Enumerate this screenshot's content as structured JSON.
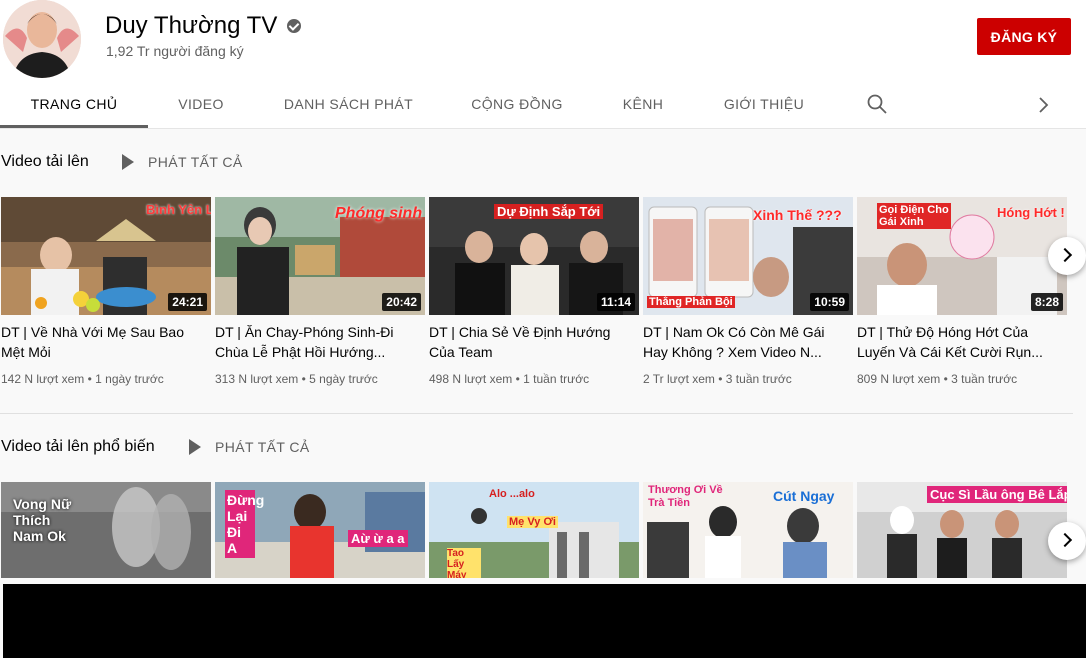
{
  "channel": {
    "name": "Duy Thường TV",
    "subscribers": "1,92 Tr người đăng ký",
    "subscribe_label": "ĐĂNG KÝ"
  },
  "tabs": [
    {
      "label": "TRANG CHỦ",
      "active": true
    },
    {
      "label": "VIDEO"
    },
    {
      "label": "DANH SÁCH PHÁT"
    },
    {
      "label": "CỘNG ĐỒNG"
    },
    {
      "label": "KÊNH"
    },
    {
      "label": "GIỚI THIỆU"
    }
  ],
  "icons": {
    "search": "search-icon",
    "chevron": "chevron-right-icon",
    "verified": "verified-icon",
    "play": "play-icon"
  },
  "colors": {
    "brand_red": "#cc0000",
    "secondary_text": "#606060",
    "background": "#f9f9f9"
  },
  "shelves": [
    {
      "title": "Video tải lên",
      "play_all": "PHÁT TẤT CẢ",
      "videos": [
        {
          "title": "DT | Về Nhà Với Mẹ Sau Bao Mệt Mỏi",
          "views": "142 N lượt xem",
          "age": "1 ngày trước",
          "duration": "24:21",
          "overlay": "Bình Yên Là Nhà"
        },
        {
          "title": "DT | Ăn Chay-Phóng Sinh-Đi Chùa Lễ Phật Hồi Hướng...",
          "views": "313 N lượt xem",
          "age": "5 ngày trước",
          "duration": "20:42",
          "overlay": "Phóng sinh"
        },
        {
          "title": "DT | Chia Sẻ Về Định Hướng Của Team",
          "views": "498 N lượt xem",
          "age": "1 tuần trước",
          "duration": "11:14",
          "overlay": "Dự Định Sắp Tới"
        },
        {
          "title": "DT | Nam Ok Có Còn Mê Gái Hay Không ? Xem Video N...",
          "views": "2 Tr lượt xem",
          "age": "3 tuần trước",
          "duration": "10:59",
          "overlay": "Xinh Thế ???",
          "overlay2": "Thằng Phản Bội"
        },
        {
          "title": "DT | Thử Độ Hóng Hớt Của Luyến Và Cái Kết Cười Rụn...",
          "views": "809 N lượt xem",
          "age": "3 tuần trước",
          "duration": "8:28",
          "overlay": "Gọi Điện Cho Gái Xinh",
          "overlay2": "Hóng Hớt !"
        }
      ]
    },
    {
      "title": "Video tải lên phổ biến",
      "play_all": "PHÁT TẤT CẢ",
      "videos": [
        {
          "overlay": "Vong Nữ Thích Nam Ok"
        },
        {
          "overlay": "Đừng Lại Đi A",
          "overlay2": "Aừ ừ a a"
        },
        {
          "overlay": "Alo ...alo",
          "overlay2": "Mẹ Vy Ơi",
          "overlay3": "Tao Lấy Máy"
        },
        {
          "overlay": "Thương Ơi Về Trà Tiền",
          "overlay2": "Cút Ngay"
        },
        {
          "overlay": "Cục Sì Lầu ông Bê Lắp !"
        }
      ]
    }
  ]
}
